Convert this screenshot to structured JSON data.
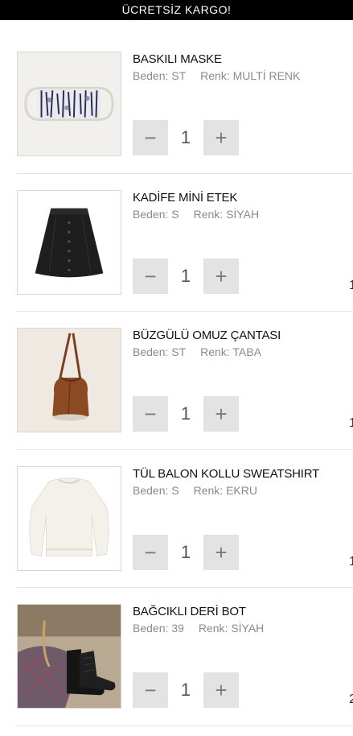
{
  "banner": {
    "text": "ÜCRETSİZ KARGO!"
  },
  "labels": {
    "size": "Beden:",
    "color": "Renk:"
  },
  "items": [
    {
      "name": "BASKILI MASKE",
      "size": "ST",
      "color": "MULTİ RENK",
      "qty": "1",
      "price_stub": "",
      "image": "mask-image"
    },
    {
      "name": "KADİFE MİNİ ETEK",
      "size": "S",
      "color": "SİYAH",
      "qty": "1",
      "price_stub": "1",
      "image": "skirt-image"
    },
    {
      "name": "BÜZGÜLÜ OMUZ ÇANTASI",
      "size": "ST",
      "color": "TABA",
      "qty": "1",
      "price_stub": "1",
      "image": "bag-image"
    },
    {
      "name": "TÜL BALON KOLLU SWEATSHIRT",
      "size": "S",
      "color": "EKRU",
      "qty": "1",
      "price_stub": "1",
      "image": "sweatshirt-image"
    },
    {
      "name": "BAĞCIKLI DERİ BOT",
      "size": "39",
      "color": "SİYAH",
      "qty": "1",
      "price_stub": "2",
      "image": "boots-image"
    }
  ],
  "controls": {
    "minus": "−",
    "plus": "+"
  }
}
